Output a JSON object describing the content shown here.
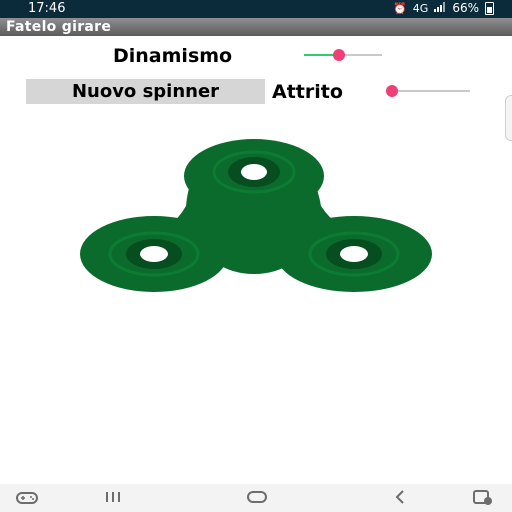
{
  "status": {
    "time": "17:46",
    "alarm_icon": "alarm-icon",
    "network": "4G",
    "signal_icon": "signal-icon",
    "battery": "66%"
  },
  "app": {
    "title": "Fatelo girare"
  },
  "controls": {
    "dinamismo_label": "Dinamismo",
    "dinamismo_value": 0.45,
    "new_spinner_label": "Nuovo spinner",
    "attrito_label": "Attrito",
    "attrito_value": 0.0
  },
  "colors": {
    "accent": "#ef3f77",
    "slider_fill": "#2ecc71",
    "spinner": "#0a6b2c",
    "spinner_dark": "#064d1f"
  },
  "navbar": {
    "game_icon": "game-controller-icon",
    "recents_icon": "recents-icon",
    "home_icon": "home-icon",
    "back_icon": "back-icon",
    "accessibility_icon": "accessibility-icon"
  }
}
